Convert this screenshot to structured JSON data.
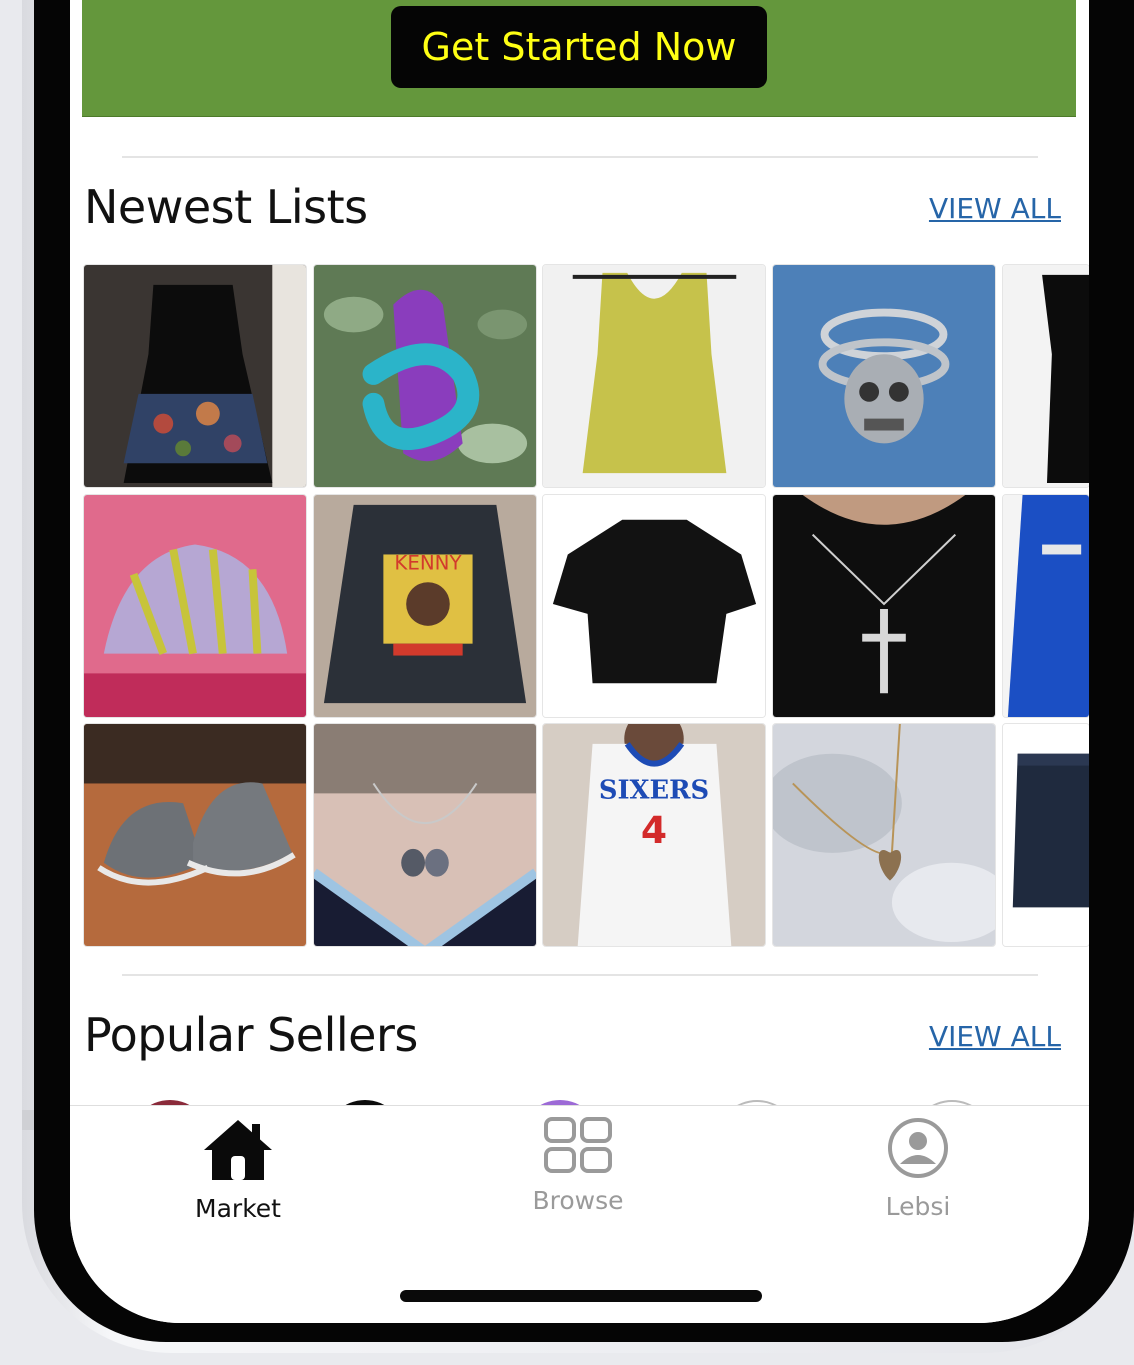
{
  "banner": {
    "cta_label": "Get Started Now",
    "color": "#64973c",
    "cta_text_color": "#ffff14"
  },
  "newest": {
    "title": "Newest Lists",
    "view_all": "VIEW ALL",
    "items": [
      {
        "name": "lace-dress"
      },
      {
        "name": "clay-sculpture"
      },
      {
        "name": "lime-tank-top"
      },
      {
        "name": "skull-ring"
      },
      {
        "name": "black-tank-partial"
      },
      {
        "name": "striped-bucket-hat"
      },
      {
        "name": "kenny-longsleeve"
      },
      {
        "name": "black-mock-top"
      },
      {
        "name": "cross-necklace"
      },
      {
        "name": "blue-racing-jacket-partial"
      },
      {
        "name": "grey-sneakers"
      },
      {
        "name": "heart-pendant-necklace"
      },
      {
        "name": "sixers-jersey"
      },
      {
        "name": "gold-heart-necklace"
      },
      {
        "name": "denim-jeans-partial"
      }
    ],
    "jersey_text": "SIXERS",
    "jersey_number": "4",
    "shirt_text": "KENNY"
  },
  "popular": {
    "title": "Popular Sellers",
    "view_all": "VIEW ALL"
  },
  "tabs": [
    {
      "label": "Market",
      "icon": "home-icon",
      "active": true
    },
    {
      "label": "Browse",
      "icon": "grid-icon",
      "active": false
    },
    {
      "label": "Lebsi",
      "icon": "user-circle-icon",
      "active": false
    }
  ]
}
